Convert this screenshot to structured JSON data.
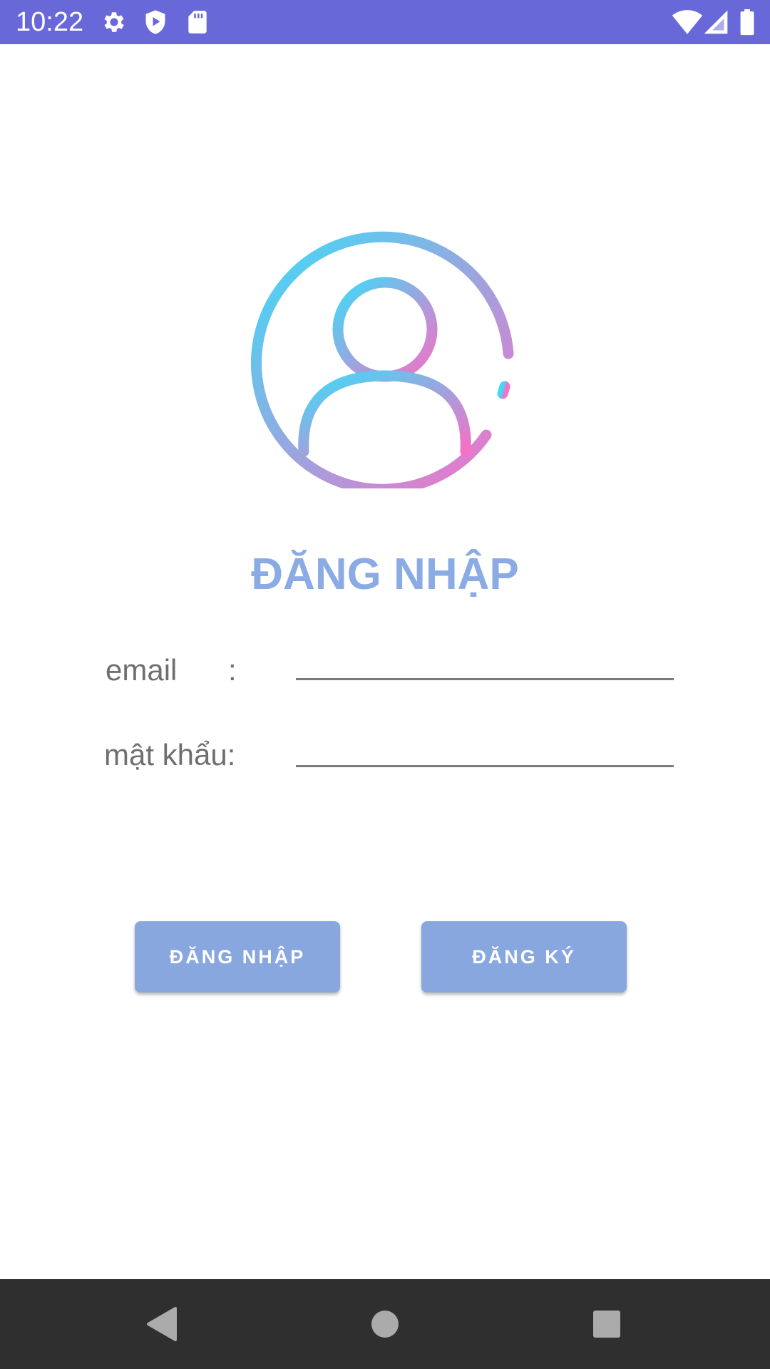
{
  "colors": {
    "status_bar": "#6868d8",
    "nav_bar": "#2f2f2f",
    "title": "#8aabe3",
    "button": "#88a7de",
    "gradient_start": "#3ddcf8",
    "gradient_end": "#f76fc6"
  },
  "status_bar": {
    "time": "10:22",
    "left_icons": [
      "gear-icon",
      "shield-play-icon",
      "sd-card-icon"
    ],
    "right_icons": [
      "wifi-icon",
      "cell-signal-icon",
      "battery-icon"
    ]
  },
  "avatar": {
    "icon": "user-circle-icon"
  },
  "login": {
    "title": "ĐĂNG NHẬP",
    "email_label": "email",
    "email_colon": ":",
    "email_value": "",
    "password_label": "mật khẩu:",
    "password_value": ""
  },
  "buttons": {
    "login": "ĐĂNG NHẬP",
    "register": "ĐĂNG KÝ"
  },
  "nav_bar": {
    "icons": [
      "back-icon",
      "home-icon",
      "recents-icon"
    ]
  }
}
